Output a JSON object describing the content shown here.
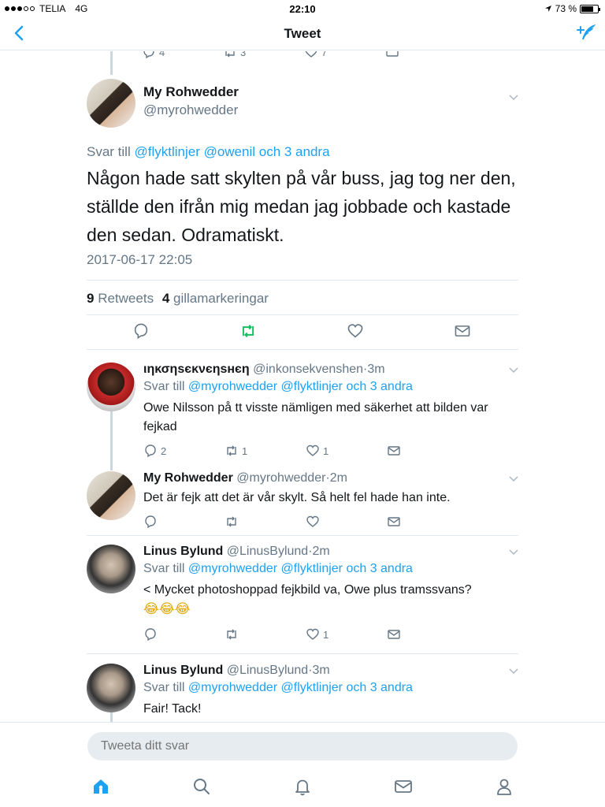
{
  "status": {
    "carrier": "TELIA",
    "network": "4G",
    "time": "22:10",
    "battery": "73 %",
    "signal_bars_filled": 3,
    "signal_bars_total": 5
  },
  "nav": {
    "title": "Tweet"
  },
  "colors": {
    "accent": "#1da1f2",
    "retweet": "#17bf63",
    "text": "#14171a",
    "muted": "#657786",
    "divider": "#e1e8ed"
  },
  "top_partial_actions": {
    "reply": "4",
    "retweet": "3",
    "like": "7"
  },
  "main_tweet": {
    "name": "My Rohwedder",
    "handle": "@myrohwedder",
    "reply_prefix": "Svar till",
    "reply_to": "@flyktlinjer @owenil och 3 andra",
    "text": "Någon hade satt skylten på vår buss, jag tog ner den, ställde den ifrån mig medan jag jobbade och kastade den sedan. Odramatiskt.",
    "timestamp": "2017-06-17 22:05",
    "retweets_count": "9",
    "retweets_label": "Retweets",
    "likes_count": "4",
    "likes_label": "gillamarkeringar"
  },
  "replies": [
    {
      "name": "ιηκσηѕєκνєηѕнєη",
      "handle": "@inkonsekvenshen",
      "time": "3m",
      "reply_prefix": "Svar till",
      "reply_to": "@myrohwedder @flyktlinjer och 3 andra",
      "text": "Owe Nilsson på tt visste nämligen med säkerhet att bilden var fejkad",
      "reply_count": "2",
      "retweet_count": "1",
      "like_count": "1"
    },
    {
      "name": "My Rohwedder",
      "handle": "@myrohwedder",
      "time": "2m",
      "text": "Det är fejk att det är vår skylt. Så helt fel hade han inte.",
      "reply_count": "",
      "retweet_count": "",
      "like_count": ""
    },
    {
      "name": "Linus Bylund",
      "handle": "@LinusBylund",
      "time": "2m",
      "reply_prefix": "Svar till",
      "reply_to": "@myrohwedder @flyktlinjer och 3 andra",
      "text": "< Mycket photoshoppad fejkbild va, Owe plus tramssvans?",
      "emoji": "😂😂😂",
      "reply_count": "",
      "retweet_count": "",
      "like_count": "1"
    },
    {
      "name": "Linus Bylund",
      "handle": "@LinusBylund",
      "time": "3m",
      "reply_prefix": "Svar till",
      "reply_to": "@myrohwedder @flyktlinjer och 3 andra",
      "text": "Fair! Tack!"
    }
  ],
  "reply_input": {
    "placeholder": "Tweeta ditt svar"
  },
  "tabs": [
    "home-icon",
    "search-icon",
    "notifications-icon",
    "messages-icon",
    "profile-icon"
  ]
}
